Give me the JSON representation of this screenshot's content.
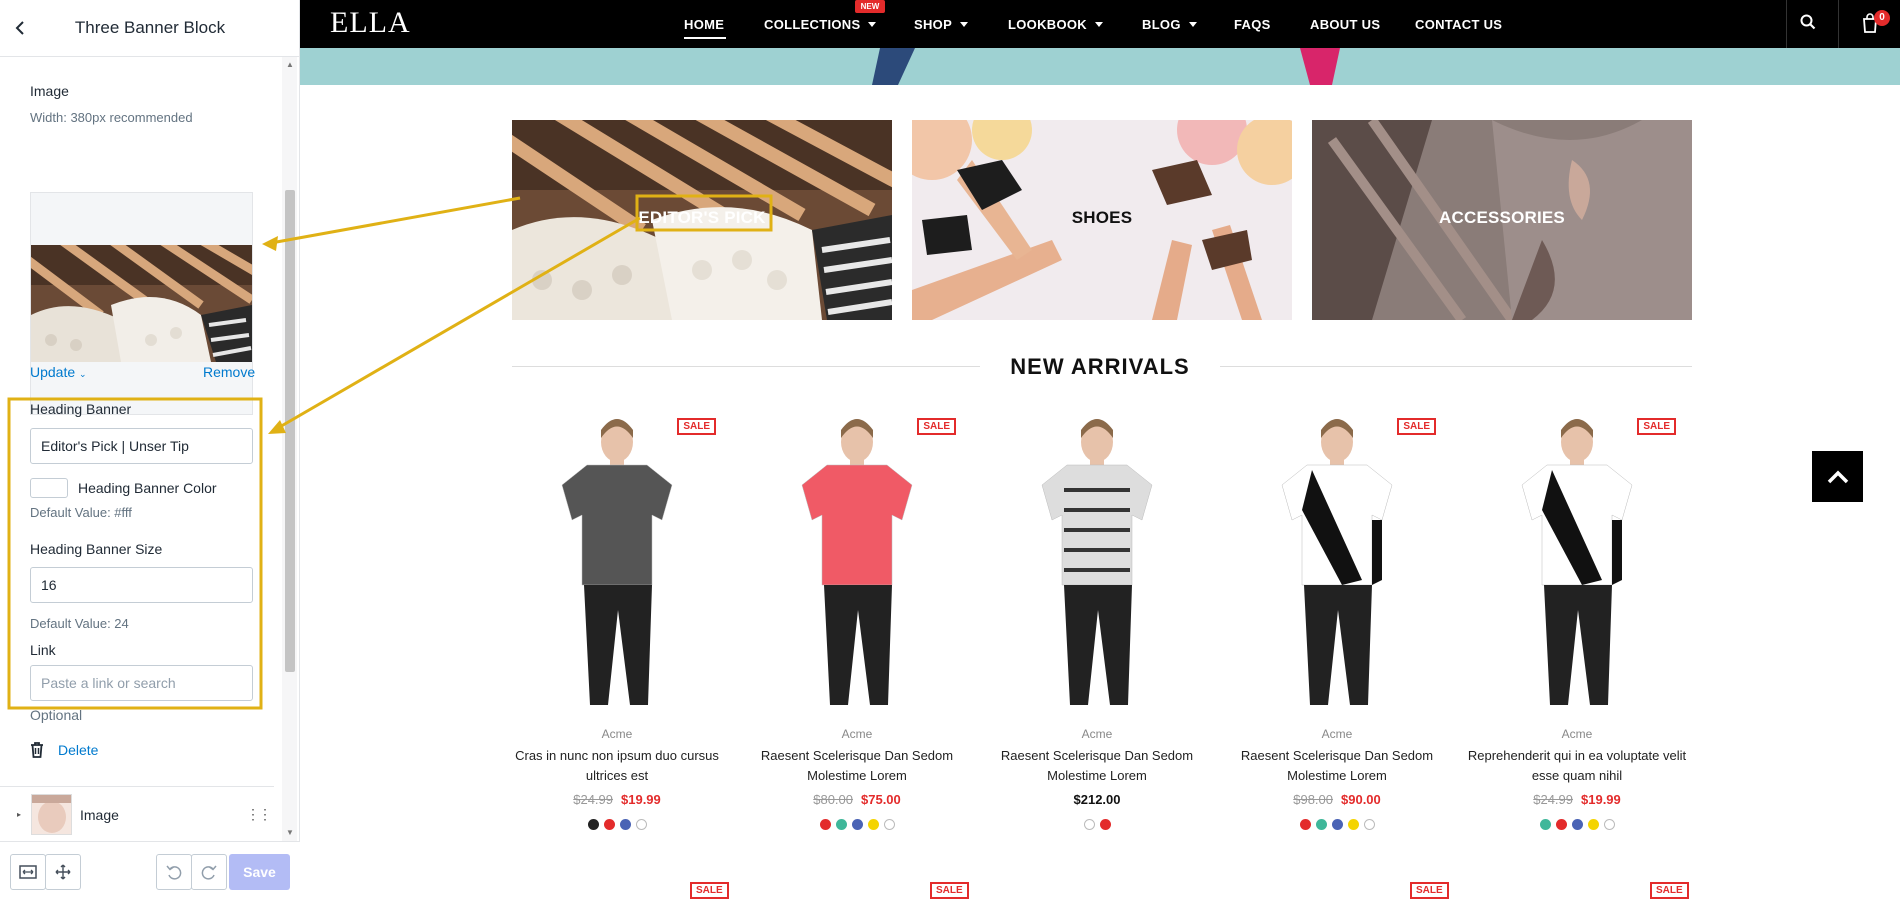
{
  "editor": {
    "title": "Three Banner Block",
    "image_label": "Image",
    "image_help": "Width: 380px recommended",
    "update_label": "Update",
    "remove_label": "Remove",
    "heading_banner_label": "Heading Banner",
    "heading_banner_value": "Editor's Pick |  Unser Tip",
    "heading_color_label": "Heading Banner Color",
    "heading_color_default": "Default Value: #fff",
    "heading_size_label": "Heading Banner Size",
    "heading_size_value": "16",
    "heading_size_default": "Default Value: 24",
    "link_label": "Link",
    "link_placeholder": "Paste a link or search",
    "link_optional": "Optional",
    "delete_label": "Delete",
    "image_block_label": "Image",
    "save_label": "Save",
    "swatch_color": "#ffffff"
  },
  "store": {
    "logo": "ELLA",
    "nav": [
      "HOME",
      "COLLECTIONS",
      "SHOP",
      "LOOKBOOK",
      "BLOG",
      "FAQS",
      "ABOUT US",
      "CONTACT US"
    ],
    "new_badge": "NEW",
    "cart_count": "0",
    "banners": [
      "EDITOR'S PICK",
      "SHOES",
      "ACCESSORIES"
    ],
    "section_title": "NEW ARRIVALS",
    "sale_label": "SALE",
    "products": [
      {
        "vendor": "Acme",
        "name": "Cras in nunc non ipsum duo cursus ultrices est",
        "old_price": "$24.99",
        "price": "$19.99",
        "colors": [
          "#222222",
          "#e32b2b",
          "#4a63b5",
          "#ffffff"
        ]
      },
      {
        "vendor": "Acme",
        "name": "Raesent Scelerisque Dan Sedom Molestime Lorem",
        "old_price": "$80.00",
        "price": "$75.00",
        "colors": [
          "#e32b2b",
          "#3fb79a",
          "#4a63b5",
          "#f4d400",
          "#ffffff"
        ]
      },
      {
        "vendor": "Acme",
        "name": "Raesent Scelerisque Dan Sedom Molestime Lorem",
        "old_price": "",
        "price": "$212.00",
        "colors": [
          "#ffffff",
          "#e32b2b"
        ]
      },
      {
        "vendor": "Acme",
        "name": "Raesent Scelerisque Dan Sedom Molestime Lorem",
        "old_price": "$98.00",
        "price": "$90.00",
        "colors": [
          "#e32b2b",
          "#3fb79a",
          "#4a63b5",
          "#f4d400",
          "#ffffff"
        ]
      },
      {
        "vendor": "Acme",
        "name": "Reprehenderit qui in ea voluptate velit esse quam nihil",
        "old_price": "$24.99",
        "price": "$19.99",
        "colors": [
          "#3fb79a",
          "#e32b2b",
          "#4a63b5",
          "#f4d400",
          "#ffffff"
        ]
      }
    ],
    "accent_color": "#e32b2b",
    "highlight_color": "#e0b115"
  }
}
